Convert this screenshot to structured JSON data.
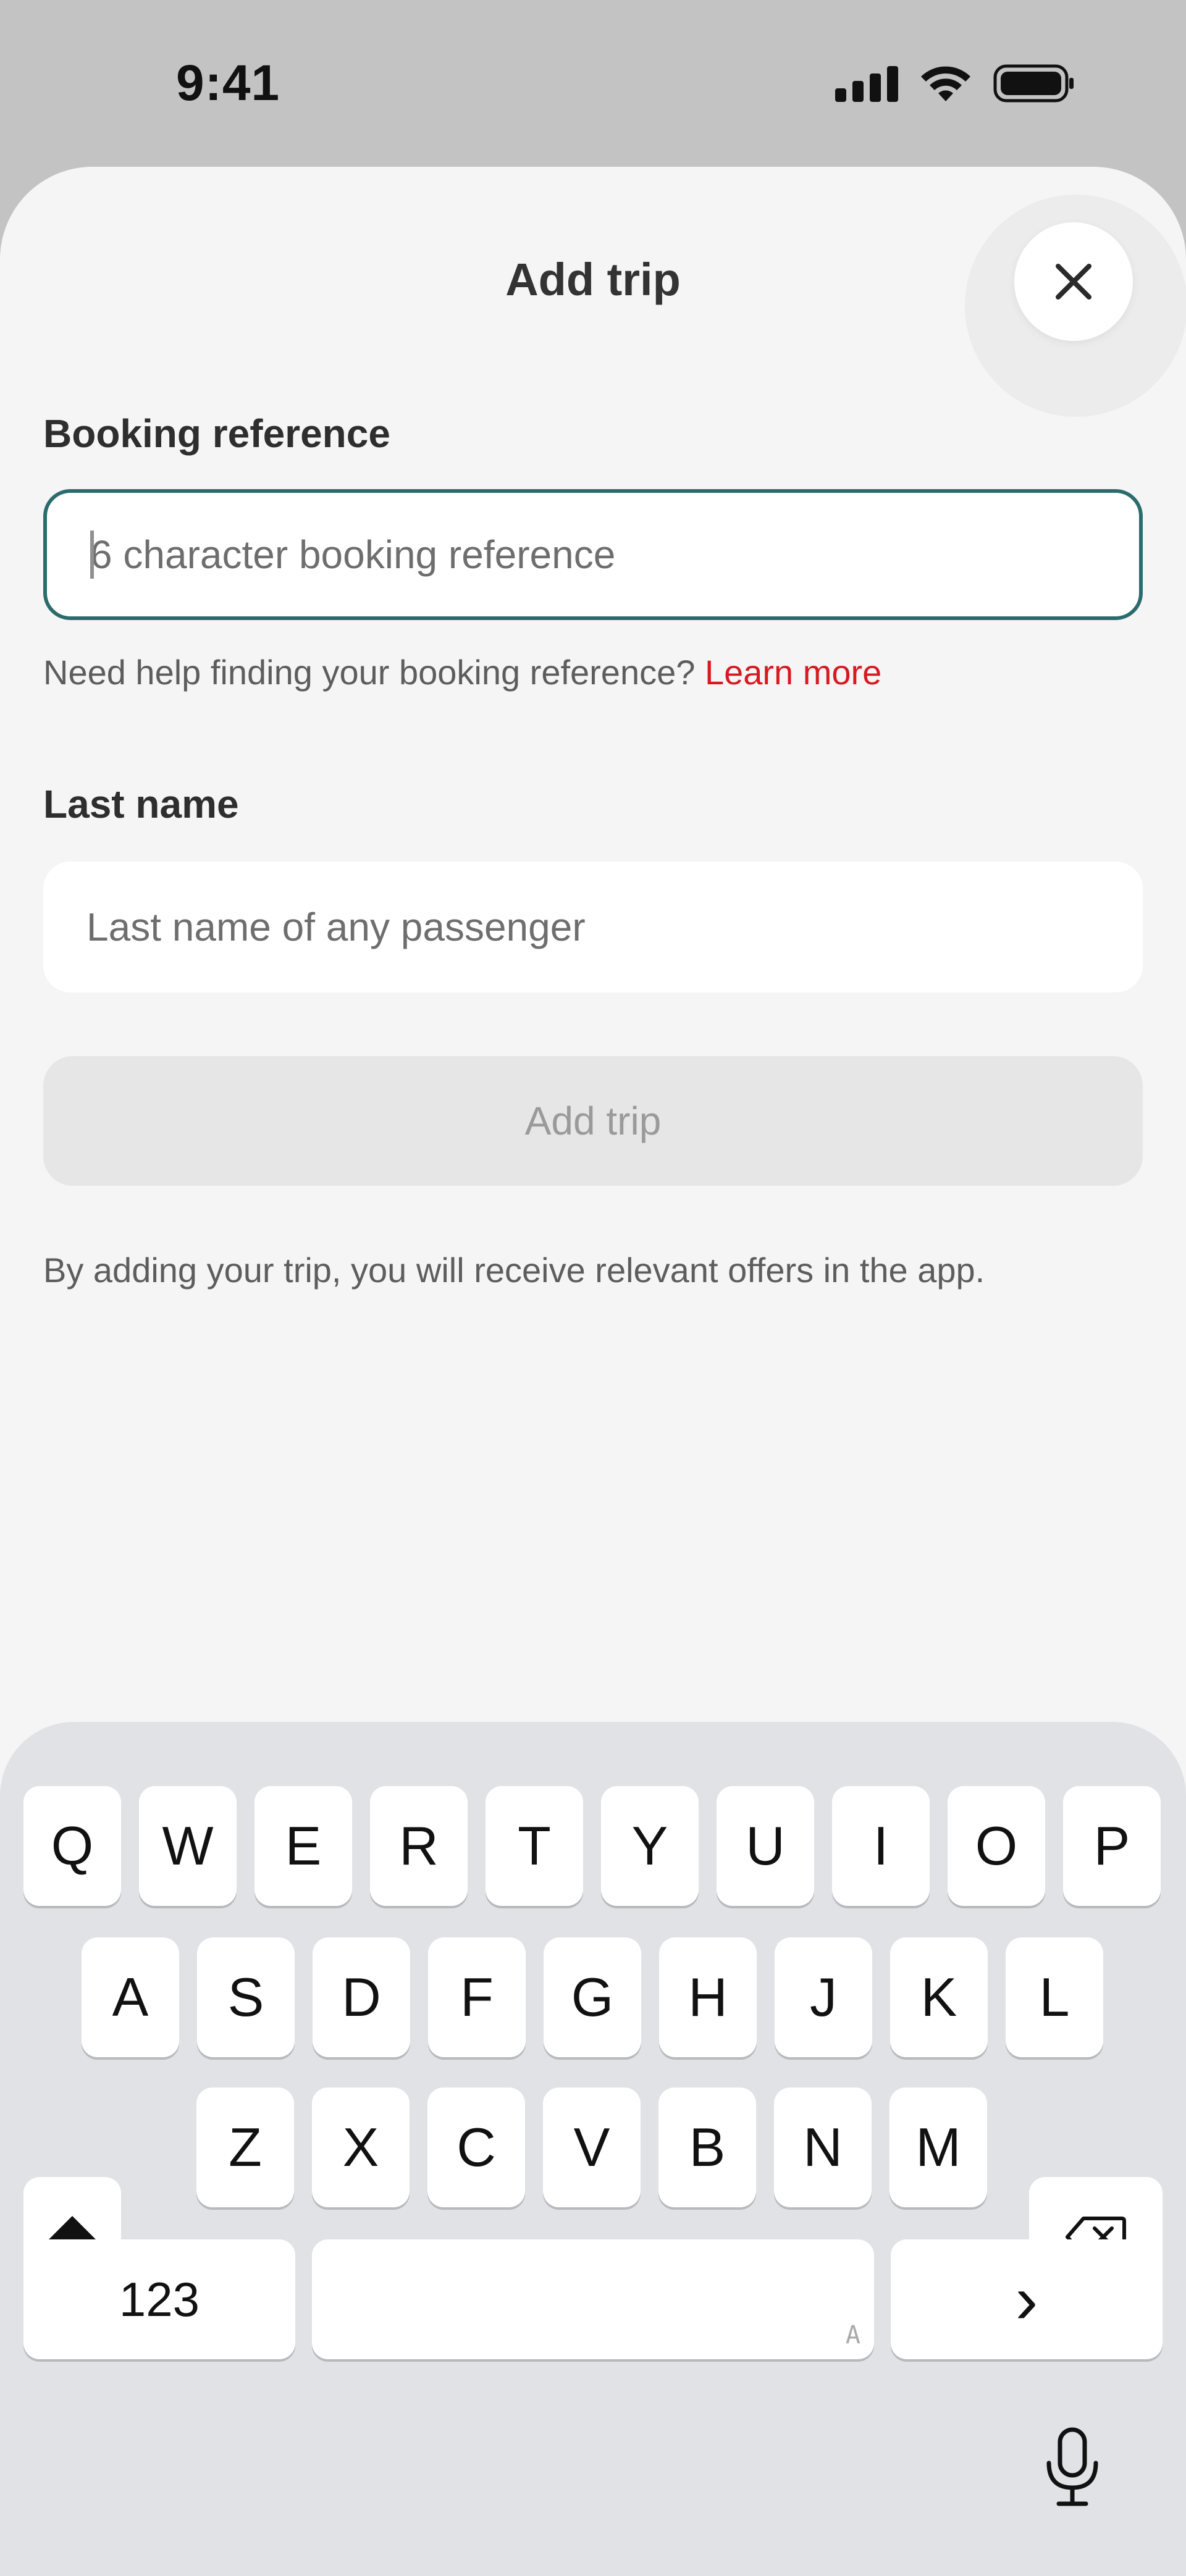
{
  "status_bar": {
    "time": "9:41",
    "icons": [
      "signal-icon",
      "wifi-icon",
      "battery-icon"
    ]
  },
  "sheet": {
    "title": "Add trip",
    "close_icon": "close-icon",
    "booking_reference": {
      "label": "Booking reference",
      "placeholder": "6 character booking reference",
      "value": ""
    },
    "help": {
      "text": "Need help finding your booking reference?",
      "link": "Learn more"
    },
    "last_name": {
      "label": "Last name",
      "placeholder": "Last name of any passenger",
      "value": ""
    },
    "submit_label": "Add trip",
    "submit_enabled": false,
    "disclaimer": "By adding your trip, you will receive relevant offers in the app."
  },
  "keyboard": {
    "row1": [
      "Q",
      "W",
      "E",
      "R",
      "T",
      "Y",
      "U",
      "I",
      "O",
      "P"
    ],
    "row2": [
      "A",
      "S",
      "D",
      "F",
      "G",
      "H",
      "J",
      "K",
      "L"
    ],
    "row3": [
      "Z",
      "X",
      "C",
      "V",
      "B",
      "N",
      "M"
    ],
    "numbers_label": "123",
    "space_hint": "A",
    "return_symbol": "›",
    "icons": [
      "shift-icon",
      "backspace-icon",
      "microphone-icon"
    ]
  },
  "colors": {
    "accent_border": "#2b6b6d",
    "link": "#d71920",
    "disabled_button": "#e6e6e6"
  }
}
